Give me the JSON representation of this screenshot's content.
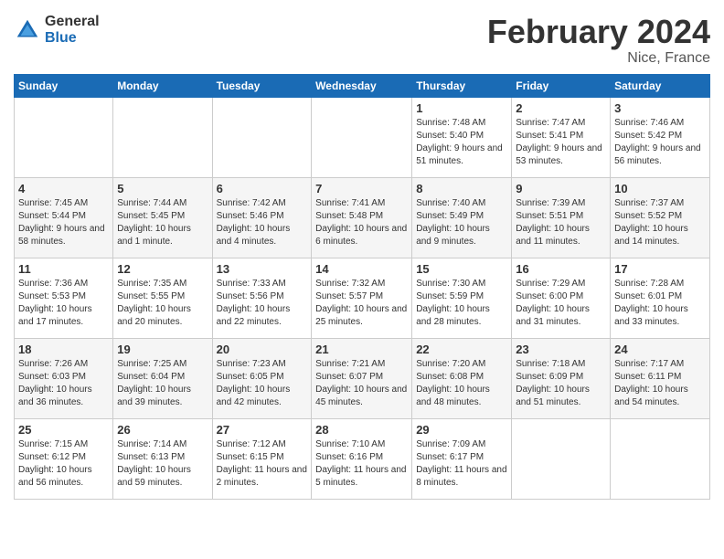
{
  "header": {
    "logo_general": "General",
    "logo_blue": "Blue",
    "month_title": "February 2024",
    "location": "Nice, France"
  },
  "days_of_week": [
    "Sunday",
    "Monday",
    "Tuesday",
    "Wednesday",
    "Thursday",
    "Friday",
    "Saturday"
  ],
  "weeks": [
    [
      {
        "day": "",
        "info": ""
      },
      {
        "day": "",
        "info": ""
      },
      {
        "day": "",
        "info": ""
      },
      {
        "day": "",
        "info": ""
      },
      {
        "day": "1",
        "info": "Sunrise: 7:48 AM\nSunset: 5:40 PM\nDaylight: 9 hours and 51 minutes."
      },
      {
        "day": "2",
        "info": "Sunrise: 7:47 AM\nSunset: 5:41 PM\nDaylight: 9 hours and 53 minutes."
      },
      {
        "day": "3",
        "info": "Sunrise: 7:46 AM\nSunset: 5:42 PM\nDaylight: 9 hours and 56 minutes."
      }
    ],
    [
      {
        "day": "4",
        "info": "Sunrise: 7:45 AM\nSunset: 5:44 PM\nDaylight: 9 hours and 58 minutes."
      },
      {
        "day": "5",
        "info": "Sunrise: 7:44 AM\nSunset: 5:45 PM\nDaylight: 10 hours and 1 minute."
      },
      {
        "day": "6",
        "info": "Sunrise: 7:42 AM\nSunset: 5:46 PM\nDaylight: 10 hours and 4 minutes."
      },
      {
        "day": "7",
        "info": "Sunrise: 7:41 AM\nSunset: 5:48 PM\nDaylight: 10 hours and 6 minutes."
      },
      {
        "day": "8",
        "info": "Sunrise: 7:40 AM\nSunset: 5:49 PM\nDaylight: 10 hours and 9 minutes."
      },
      {
        "day": "9",
        "info": "Sunrise: 7:39 AM\nSunset: 5:51 PM\nDaylight: 10 hours and 11 minutes."
      },
      {
        "day": "10",
        "info": "Sunrise: 7:37 AM\nSunset: 5:52 PM\nDaylight: 10 hours and 14 minutes."
      }
    ],
    [
      {
        "day": "11",
        "info": "Sunrise: 7:36 AM\nSunset: 5:53 PM\nDaylight: 10 hours and 17 minutes."
      },
      {
        "day": "12",
        "info": "Sunrise: 7:35 AM\nSunset: 5:55 PM\nDaylight: 10 hours and 20 minutes."
      },
      {
        "day": "13",
        "info": "Sunrise: 7:33 AM\nSunset: 5:56 PM\nDaylight: 10 hours and 22 minutes."
      },
      {
        "day": "14",
        "info": "Sunrise: 7:32 AM\nSunset: 5:57 PM\nDaylight: 10 hours and 25 minutes."
      },
      {
        "day": "15",
        "info": "Sunrise: 7:30 AM\nSunset: 5:59 PM\nDaylight: 10 hours and 28 minutes."
      },
      {
        "day": "16",
        "info": "Sunrise: 7:29 AM\nSunset: 6:00 PM\nDaylight: 10 hours and 31 minutes."
      },
      {
        "day": "17",
        "info": "Sunrise: 7:28 AM\nSunset: 6:01 PM\nDaylight: 10 hours and 33 minutes."
      }
    ],
    [
      {
        "day": "18",
        "info": "Sunrise: 7:26 AM\nSunset: 6:03 PM\nDaylight: 10 hours and 36 minutes."
      },
      {
        "day": "19",
        "info": "Sunrise: 7:25 AM\nSunset: 6:04 PM\nDaylight: 10 hours and 39 minutes."
      },
      {
        "day": "20",
        "info": "Sunrise: 7:23 AM\nSunset: 6:05 PM\nDaylight: 10 hours and 42 minutes."
      },
      {
        "day": "21",
        "info": "Sunrise: 7:21 AM\nSunset: 6:07 PM\nDaylight: 10 hours and 45 minutes."
      },
      {
        "day": "22",
        "info": "Sunrise: 7:20 AM\nSunset: 6:08 PM\nDaylight: 10 hours and 48 minutes."
      },
      {
        "day": "23",
        "info": "Sunrise: 7:18 AM\nSunset: 6:09 PM\nDaylight: 10 hours and 51 minutes."
      },
      {
        "day": "24",
        "info": "Sunrise: 7:17 AM\nSunset: 6:11 PM\nDaylight: 10 hours and 54 minutes."
      }
    ],
    [
      {
        "day": "25",
        "info": "Sunrise: 7:15 AM\nSunset: 6:12 PM\nDaylight: 10 hours and 56 minutes."
      },
      {
        "day": "26",
        "info": "Sunrise: 7:14 AM\nSunset: 6:13 PM\nDaylight: 10 hours and 59 minutes."
      },
      {
        "day": "27",
        "info": "Sunrise: 7:12 AM\nSunset: 6:15 PM\nDaylight: 11 hours and 2 minutes."
      },
      {
        "day": "28",
        "info": "Sunrise: 7:10 AM\nSunset: 6:16 PM\nDaylight: 11 hours and 5 minutes."
      },
      {
        "day": "29",
        "info": "Sunrise: 7:09 AM\nSunset: 6:17 PM\nDaylight: 11 hours and 8 minutes."
      },
      {
        "day": "",
        "info": ""
      },
      {
        "day": "",
        "info": ""
      }
    ]
  ]
}
